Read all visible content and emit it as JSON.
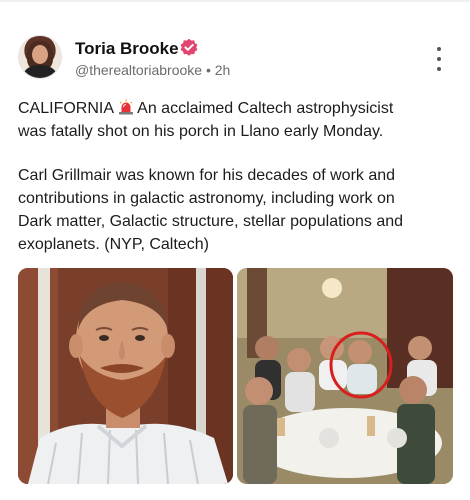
{
  "post": {
    "author": {
      "name": "Toria Brooke",
      "handle": "@therealtoriabrooke",
      "separator": "•",
      "time": "2h"
    },
    "paragraphs": {
      "line1_a": "CALIFORNIA",
      "line1_b": " An acclaimed Caltech astrophysicist",
      "line2": "was fatally shot on his porch in Llano early Monday.",
      "p2": [
        "Carl Grillmair was known for his decades of work and",
        "contributions in galactic astronomy, including work on",
        "Dark matter, Galactic structure, stellar populations and",
        "exoplanets. (NYP, Caltech)"
      ]
    }
  },
  "colors": {
    "verified": "#e2466f",
    "highlight_circle": "#d81e1e"
  },
  "icons": {
    "verified": "verified-badge-icon",
    "siren": "siren-emoji-icon",
    "more": "more-options-icon"
  }
}
